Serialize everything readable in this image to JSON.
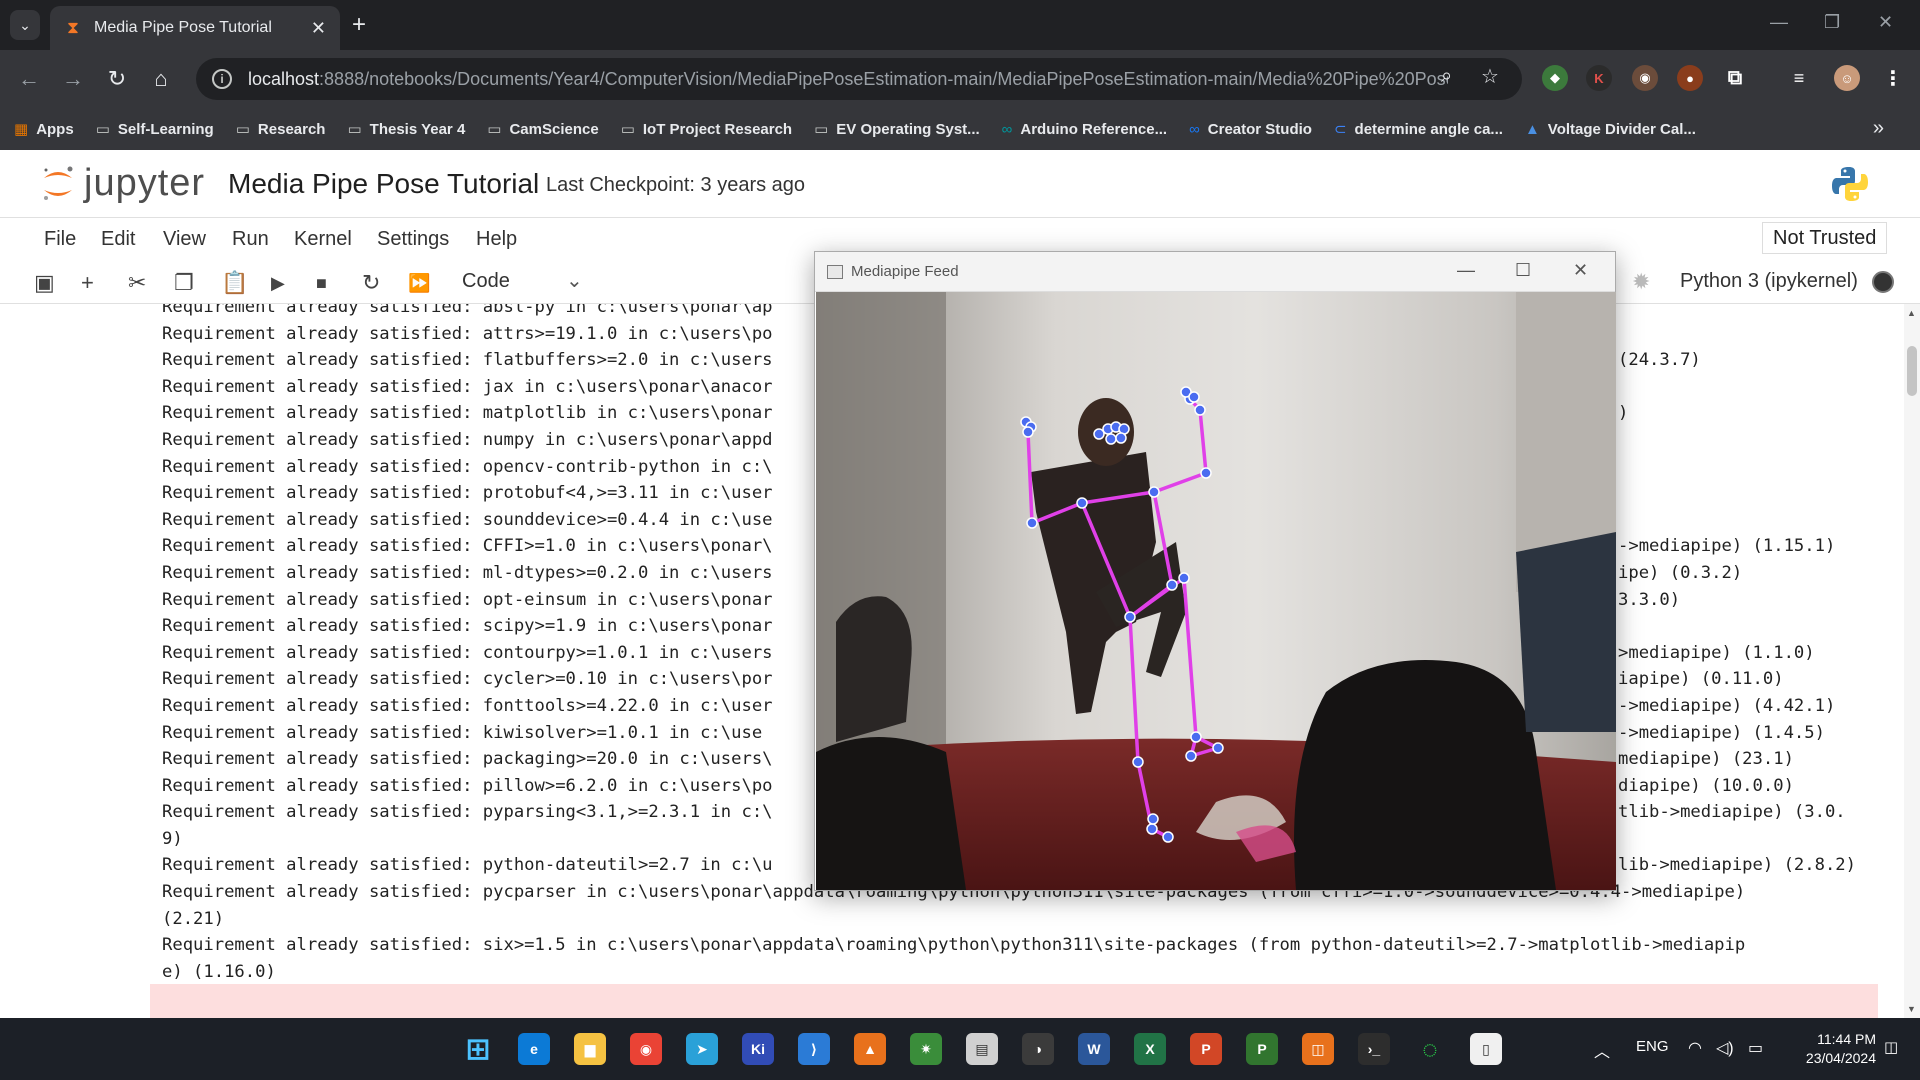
{
  "browser": {
    "tab_title": "Media Pipe Pose Tutorial",
    "url_host": "localhost",
    "url_rest": ":8888/notebooks/Documents/Year4/ComputerVision/MediaPipePoseEstimation-main/MediaPipePoseEstimation-main/Media%20Pipe%20Pose...",
    "bookmarks": [
      {
        "label": "Apps",
        "icon": "apps-grid-icon"
      },
      {
        "label": "Self-Learning",
        "icon": "folder-icon"
      },
      {
        "label": "Research",
        "icon": "folder-icon"
      },
      {
        "label": "Thesis Year 4",
        "icon": "folder-icon"
      },
      {
        "label": "CamScience",
        "icon": "folder-icon"
      },
      {
        "label": "IoT Project Research",
        "icon": "folder-icon"
      },
      {
        "label": "EV Operating Syst...",
        "icon": "folder-icon"
      },
      {
        "label": "Arduino Reference...",
        "icon": "arduino-icon"
      },
      {
        "label": "Creator Studio",
        "icon": "meta-icon"
      },
      {
        "label": "determine angle ca...",
        "icon": "site-icon"
      },
      {
        "label": "Voltage Divider Cal...",
        "icon": "triangle-icon"
      }
    ]
  },
  "jupyter": {
    "logo_text": "jupyter",
    "notebook_title": "Media Pipe Pose Tutorial",
    "checkpoint": "Last Checkpoint: 3 years ago",
    "menu": [
      "File",
      "Edit",
      "View",
      "Run",
      "Kernel",
      "Settings",
      "Help"
    ],
    "trust": "Not Trusted",
    "cell_type": "Code",
    "kernel": "Python 3 (ipykernel)"
  },
  "output_lines": [
    {
      "left": "Requirement already satisfied: absl-py in c:\\users\\ponar\\ap",
      "right": ""
    },
    {
      "left": "Requirement already satisfied: attrs>=19.1.0 in c:\\users\\po",
      "right": ""
    },
    {
      "left": "Requirement already satisfied: flatbuffers>=2.0 in c:\\users",
      "right": "(24.3.7)"
    },
    {
      "left": "Requirement already satisfied: jax in c:\\users\\ponar\\anacor",
      "right": ""
    },
    {
      "left": "Requirement already satisfied: matplotlib in c:\\users\\ponar",
      "right": ")"
    },
    {
      "left": "Requirement already satisfied: numpy in c:\\users\\ponar\\appd",
      "right": ""
    },
    {
      "left": "Requirement already satisfied: opencv-contrib-python in c:\\",
      "right": ""
    },
    {
      "left": "Requirement already satisfied: protobuf<4,>=3.11 in c:\\user",
      "right": ""
    },
    {
      "left": "Requirement already satisfied: sounddevice>=0.4.4 in c:\\use",
      "right": ""
    },
    {
      "left": "Requirement already satisfied: CFFI>=1.0 in c:\\users\\ponar\\",
      "right": "->mediapipe) (1.15.1)"
    },
    {
      "left": "Requirement already satisfied: ml-dtypes>=0.2.0 in c:\\users",
      "right": "ipe) (0.3.2)"
    },
    {
      "left": "Requirement already satisfied: opt-einsum in c:\\users\\ponar",
      "right": "3.3.0)"
    },
    {
      "left": "Requirement already satisfied: scipy>=1.9 in c:\\users\\ponar",
      "right": ""
    },
    {
      "left": "Requirement already satisfied: contourpy>=1.0.1 in c:\\users",
      "right": ">mediapipe) (1.1.0)"
    },
    {
      "left": "Requirement already satisfied: cycler>=0.10 in c:\\users\\por",
      "right": "iapipe) (0.11.0)"
    },
    {
      "left": "Requirement already satisfied: fonttools>=4.22.0 in c:\\user",
      "right": "->mediapipe) (4.42.1)"
    },
    {
      "left": "Requirement already satisfied: kiwisolver>=1.0.1 in c:\\use",
      "right": "->mediapipe) (1.4.5)"
    },
    {
      "left": "Requirement already satisfied: packaging>=20.0 in c:\\users\\",
      "right": "mediapipe) (23.1)"
    },
    {
      "left": "Requirement already satisfied: pillow>=6.2.0 in c:\\users\\po",
      "right": "diapipe) (10.0.0)"
    },
    {
      "left": "Requirement already satisfied: pyparsing<3.1,>=2.3.1 in c:\\",
      "right": "tlib->mediapipe) (3.0."
    },
    {
      "left": "9)",
      "right": ""
    },
    {
      "left": "Requirement already satisfied: python-dateutil>=2.7 in c:\\u",
      "right": "lib->mediapipe) (2.8.2)"
    },
    {
      "left": "Requirement already satisfied: pycparser in c:\\users\\ponar\\appdata\\roaming\\python\\python311\\site-packages (from cffi>=1.0->sounddevice>=0.4.4->mediapipe)",
      "right": ""
    },
    {
      "left": "(2.21)",
      "right": ""
    },
    {
      "left": "Requirement already satisfied: six>=1.5 in c:\\users\\ponar\\appdata\\roaming\\python\\python311\\site-packages (from python-dateutil>=2.7->matplotlib->mediapip",
      "right": ""
    },
    {
      "left": "e) (1.16.0)",
      "right": ""
    }
  ],
  "cv_window": {
    "title": "Mediapipe Feed",
    "pose_color": "#e040e8",
    "landmark_color": "#4a6cf0"
  },
  "taskbar": {
    "lang": "ENG",
    "time": "11:44 PM",
    "date": "23/04/2024",
    "apps": [
      "windows-start-icon",
      "edge-icon",
      "file-explorer-icon",
      "chrome-icon",
      "telegram-icon",
      "kicad-icon",
      "vscode-icon",
      "matlab-icon",
      "anaconda-icon",
      "app-icon",
      "davinci-icon",
      "word-icon",
      "excel-icon",
      "powerpoint-icon",
      "project-icon",
      "office-pdf-icon",
      "terminal-icon",
      "loading-icon",
      "notepad-icon"
    ]
  },
  "theme": {
    "chrome_dark": "#202124",
    "chrome_mid": "#35363a",
    "jupyter_orange": "#f37726",
    "stderr_bg": "#fddede"
  }
}
